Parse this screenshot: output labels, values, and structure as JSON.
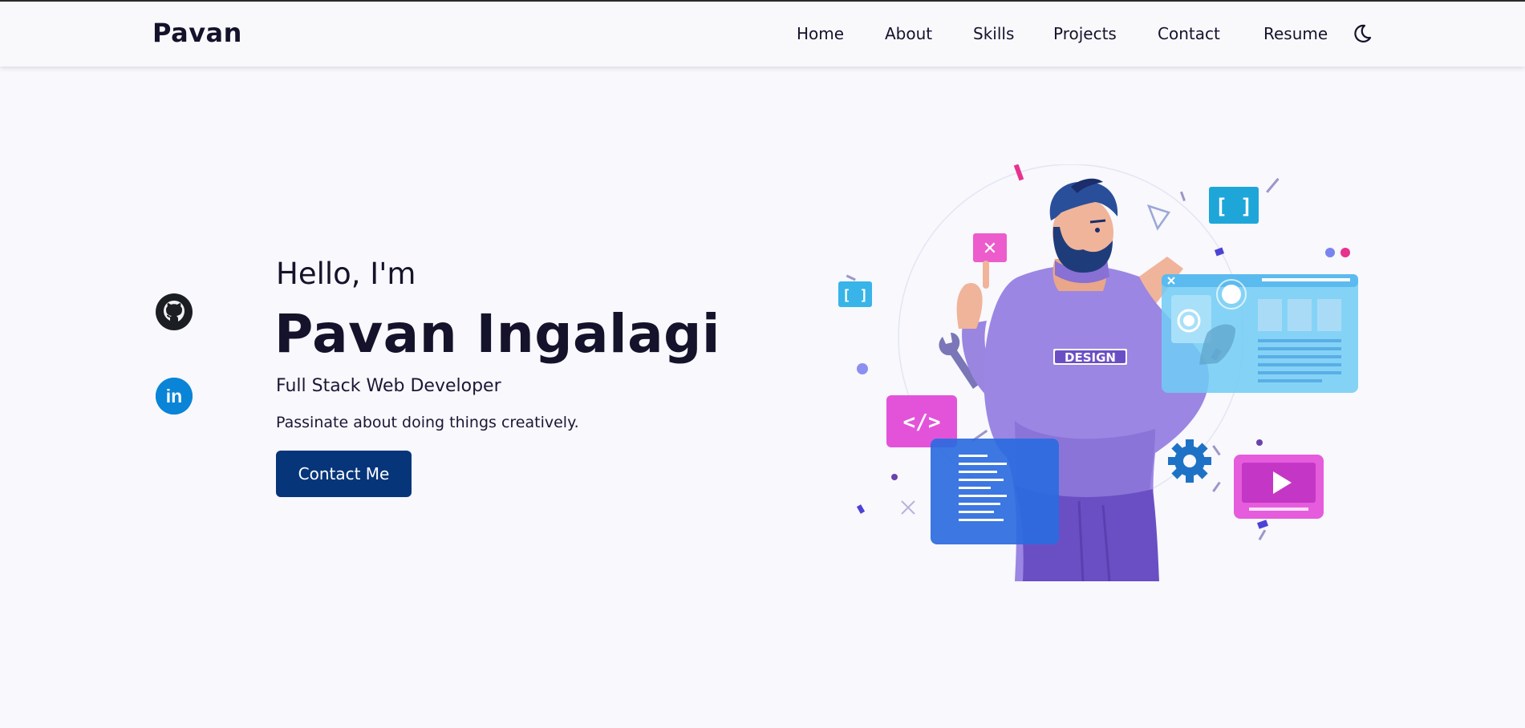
{
  "header": {
    "logo": "Pavan",
    "nav": [
      {
        "label": "Home"
      },
      {
        "label": "About"
      },
      {
        "label": "Skills"
      },
      {
        "label": "Projects"
      },
      {
        "label": "Contact"
      },
      {
        "label": "Resume"
      }
    ],
    "theme_toggle_icon": "moon-icon"
  },
  "social": [
    {
      "icon": "github-icon"
    },
    {
      "icon": "linkedin-icon",
      "text": "in"
    }
  ],
  "hero": {
    "greeting": "Hello, I'm",
    "name": "Pavan Ingalagi",
    "role": "Full Stack Web Developer",
    "tagline": "Passinate about doing things creatively.",
    "cta_label": "Contact Me",
    "illustration": {
      "badge_text": "DESIGN",
      "code_tag": "</>",
      "brackets": "[ ]",
      "close_mark": "✕"
    }
  },
  "colors": {
    "background": "#f8f8fd",
    "text": "#14132b",
    "button": "#06357a",
    "linkedin": "#0a84d6",
    "accent_purple": "#9c85e0",
    "accent_pink": "#e24ad8",
    "accent_cyan": "#38b8e6"
  }
}
